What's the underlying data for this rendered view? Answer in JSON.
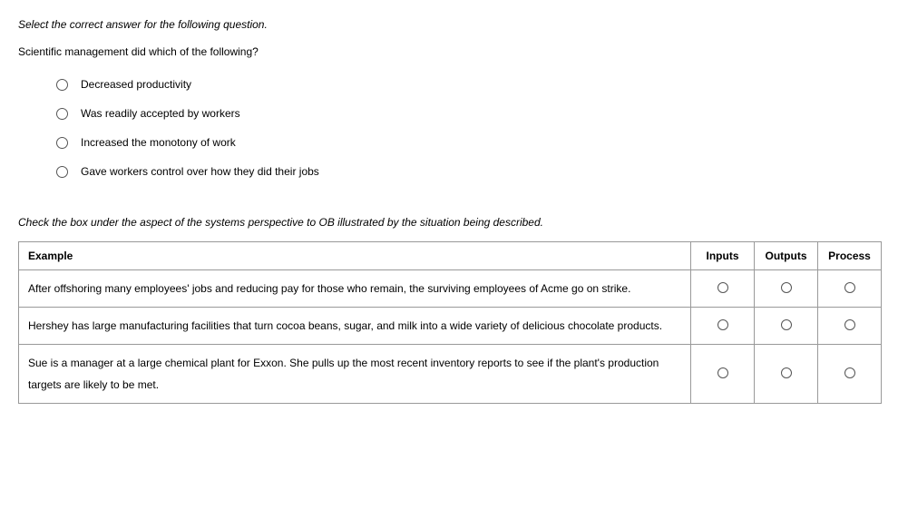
{
  "question1": {
    "instruction": "Select the correct answer for the following question.",
    "stem": "Scientific management did which of the following?",
    "options": [
      "Decreased productivity",
      "Was readily accepted by workers",
      "Increased the monotony of work",
      "Gave workers control over how they did their jobs"
    ]
  },
  "question2": {
    "instruction": "Check the box under the aspect of the systems perspective to OB illustrated by the situation being described.",
    "headers": {
      "example": "Example",
      "col1": "Inputs",
      "col2": "Outputs",
      "col3": "Process"
    },
    "rows": [
      "After offshoring many employees' jobs and reducing pay for those who remain, the surviving employees of Acme go on strike.",
      "Hershey has large manufacturing facilities that turn cocoa beans, sugar, and milk into a wide variety of delicious chocolate products.",
      "Sue is a manager at a large chemical plant for Exxon. She pulls up the most recent inventory reports to see if the plant's production targets are likely to be met."
    ]
  }
}
